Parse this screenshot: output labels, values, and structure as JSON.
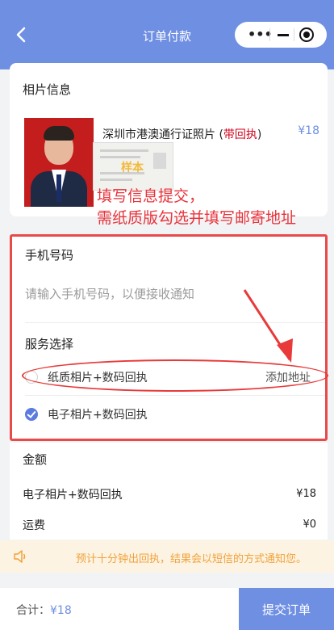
{
  "nav": {
    "title": "订单付款",
    "back_icon": "chevron-left-icon",
    "capsule_dots": "•••"
  },
  "photo_info": {
    "title": "相片信息",
    "product_name": "深圳市港澳通行证照片 (",
    "receipt_tag": "带回执",
    "product_name_end": ")",
    "price": "¥18",
    "sample_stamp": "样本"
  },
  "annotation": {
    "line1": "填写信息提交，",
    "line2": "需纸质版勾选并填写邮寄地址",
    "color": "#e8333b"
  },
  "phone": {
    "label": "手机号码",
    "placeholder": "请输入手机号码，以便接收通知"
  },
  "service": {
    "label": "服务选择",
    "options": [
      {
        "label": "纸质相片+数码回执",
        "selected": false,
        "action": "添加地址"
      },
      {
        "label": "电子相片+数码回执",
        "selected": true
      }
    ]
  },
  "amount": {
    "title": "金额",
    "rows": [
      {
        "label": "电子相片+数码回执",
        "value": "¥18"
      },
      {
        "label": "运费",
        "value": "¥0"
      }
    ]
  },
  "notice": {
    "text": "预计十分钟出回执，结果会以短信的方式通知您。"
  },
  "footer": {
    "total_label": "合计：",
    "total_value": "¥18",
    "submit_label": "提交订单"
  },
  "colors": {
    "primary": "#6f8fe3",
    "highlight_red": "#e84a4a",
    "notice_text": "#f0a23a"
  }
}
